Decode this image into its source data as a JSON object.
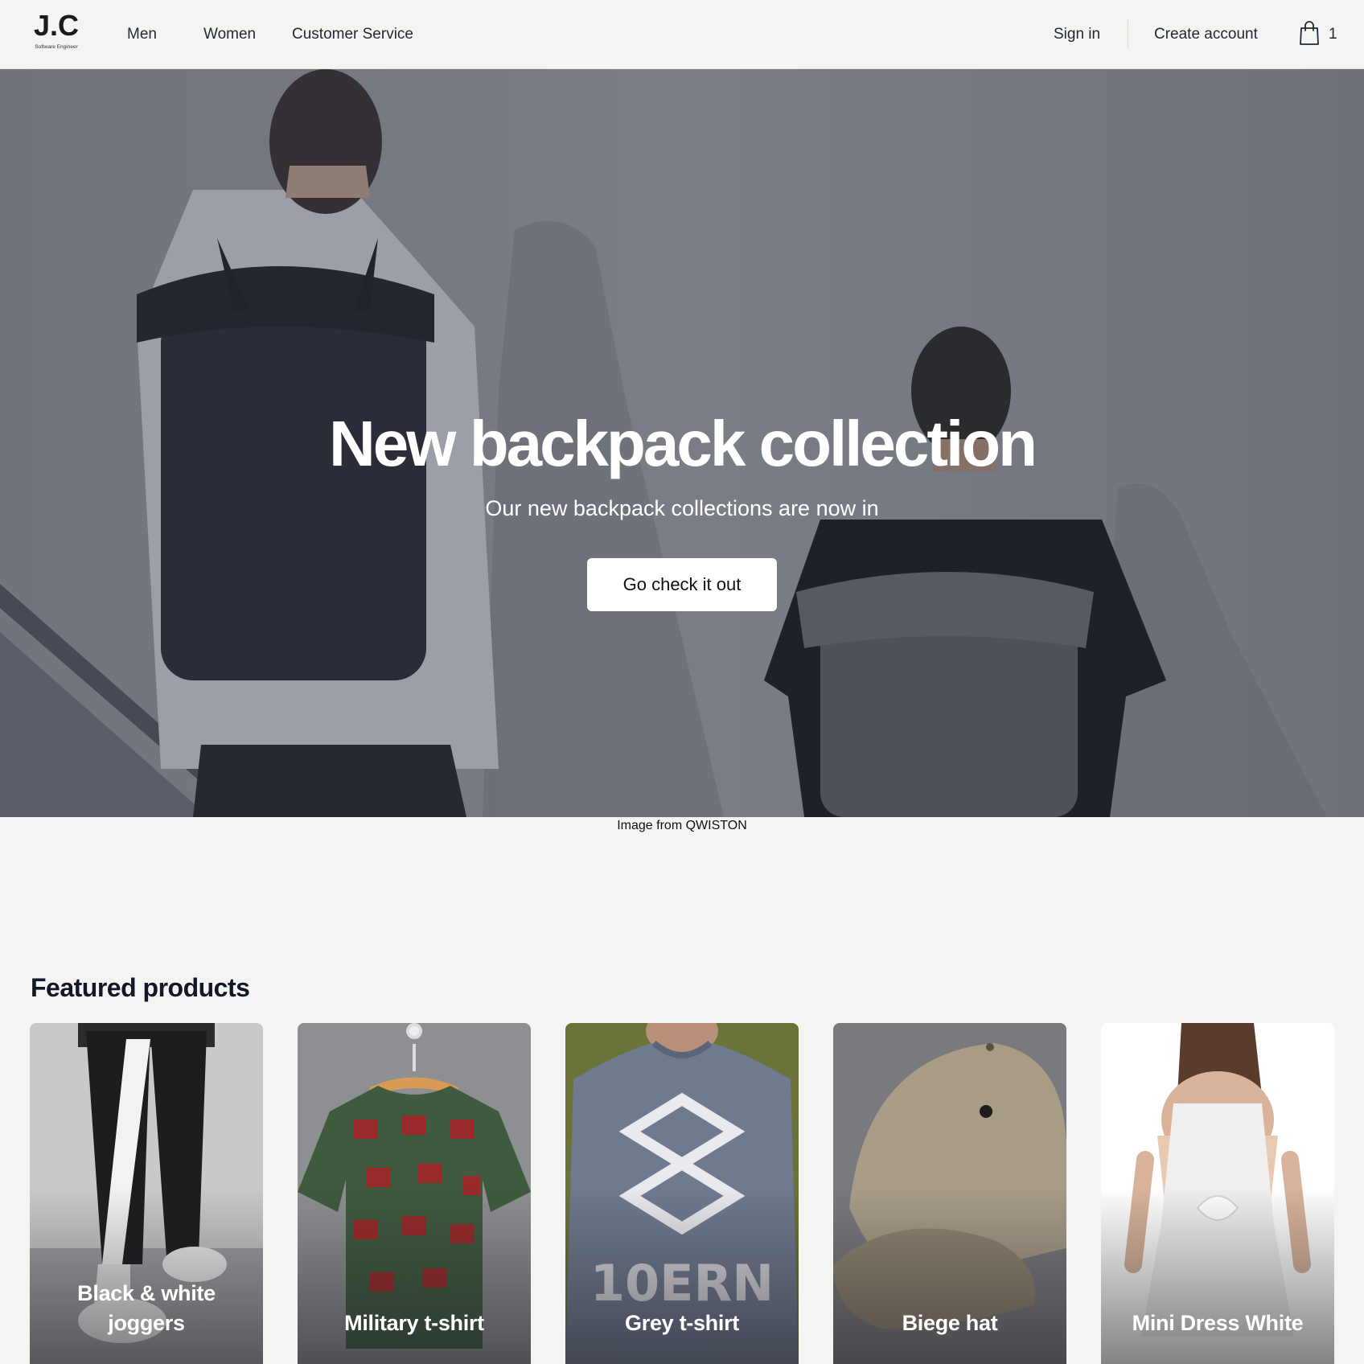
{
  "brand": {
    "logo_text": "J.C",
    "logo_subtitle": "Software Engineer"
  },
  "nav": {
    "men": "Men",
    "women": "Women",
    "customer_service": "Customer Service",
    "sign_in": "Sign in",
    "create_account": "Create account",
    "cart_count": "1"
  },
  "hero": {
    "title": "New backpack collection",
    "subtitle": "Our new backpack collections are now in",
    "cta_label": "Go check it out",
    "image_credit": "Image from QWISTON"
  },
  "featured": {
    "title": "Featured products",
    "products": [
      {
        "name": "Black & white joggers"
      },
      {
        "name": "Military t-shirt"
      },
      {
        "name": "Grey t-shirt"
      },
      {
        "name": "Biege hat"
      },
      {
        "name": "Mini Dress White"
      }
    ]
  },
  "colors": {
    "page_background": "#f4f4f2",
    "text_primary": "#111827",
    "button_background": "#ffffff"
  }
}
